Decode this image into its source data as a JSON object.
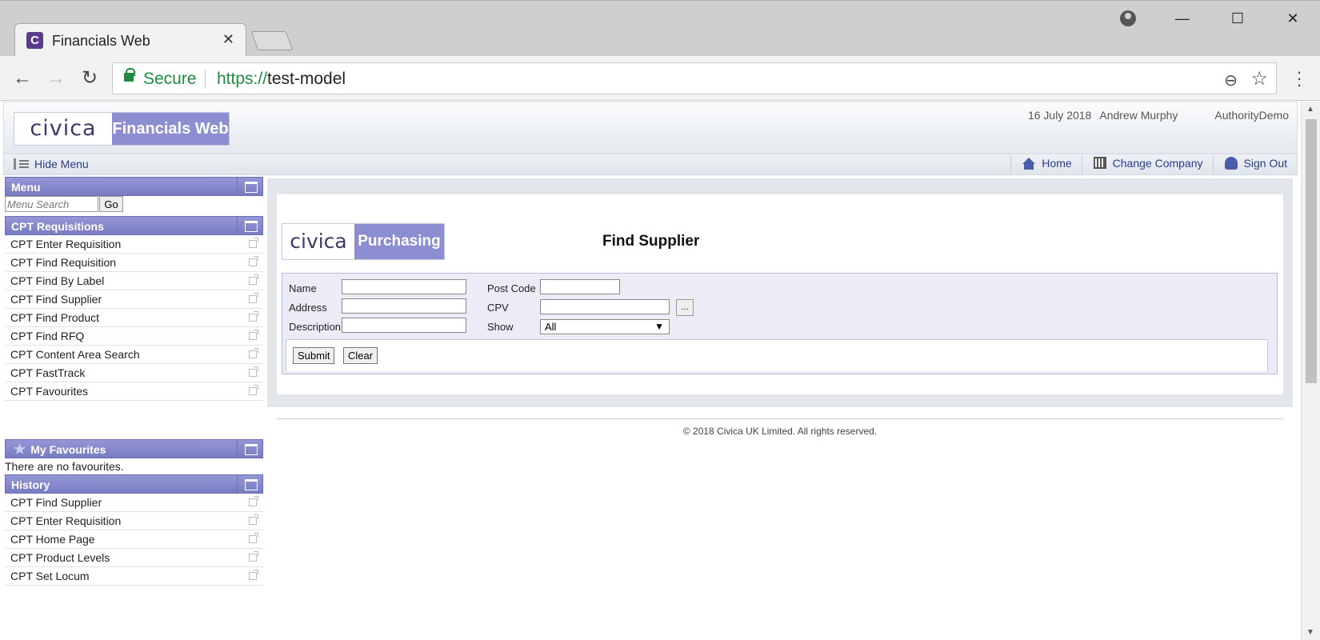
{
  "browser": {
    "tab_title": "Financials Web",
    "tab_favicon_letter": "C",
    "secure_label": "Secure",
    "url_scheme": "https://",
    "url_host": "test-model"
  },
  "app": {
    "logo_text": "civica",
    "product_name": "Financials Web",
    "date": "16 July 2018",
    "user": "Andrew Murphy",
    "authority": "AuthorityDemo"
  },
  "toolbar": {
    "hide_menu": "Hide Menu",
    "home": "Home",
    "change_company": "Change Company",
    "sign_out": "Sign Out"
  },
  "sidebar": {
    "menu_title": "Menu",
    "search_placeholder": "Menu Search",
    "go_label": "Go",
    "requisitions_title": "CPT Requisitions",
    "requisition_items": [
      "CPT Enter Requisition",
      "CPT Find Requisition",
      "CPT Find By Label",
      "CPT Find Supplier",
      "CPT Find Product",
      "CPT Find RFQ",
      "CPT Content Area Search",
      "CPT FastTrack",
      "CPT Favourites"
    ],
    "favourites_title": "My Favourites",
    "no_favourites": "There are no favourites.",
    "history_title": "History",
    "history_items": [
      "CPT Find Supplier",
      "CPT Enter Requisition",
      "CPT Home Page",
      "CPT Product Levels",
      "CPT Set Locum"
    ]
  },
  "main": {
    "logo_text": "civica",
    "module_name": "Purchasing",
    "page_title": "Find Supplier",
    "form": {
      "name_label": "Name",
      "address_label": "Address",
      "description_label": "Description",
      "postcode_label": "Post Code",
      "cpv_label": "CPV",
      "show_label": "Show",
      "show_value": "All",
      "ellipsis_label": "...",
      "submit_label": "Submit",
      "clear_label": "Clear"
    }
  },
  "footer": {
    "copyright": "© 2018 Civica UK Limited. All rights reserved."
  },
  "colors": {
    "accent": "#8c8ed1",
    "panel_header": "#7a7cc2",
    "link": "#2b3b8a",
    "secure_green": "#1e8e3e"
  }
}
